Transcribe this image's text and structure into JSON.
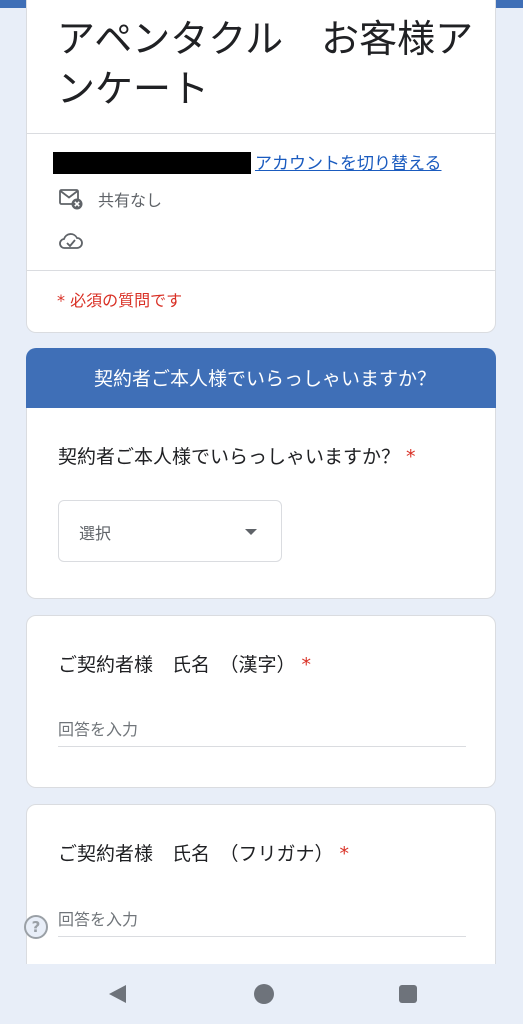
{
  "form": {
    "title": "アペンタクル　お客様アンケート",
    "switch_account_label": "アカウントを切り替える",
    "sharing_status": "共有なし",
    "required_note": "* 必須の質問です"
  },
  "section": {
    "title": "契約者ご本人様でいらっしゃいますか？"
  },
  "questions": [
    {
      "title": "契約者ご本人様でいらっしゃいますか？",
      "required_mark": "*",
      "type": "select",
      "selected": "選択"
    },
    {
      "title": "ご契約者様　氏名　（漢字）",
      "required_mark": "*",
      "type": "text",
      "placeholder": "回答を入力"
    },
    {
      "title": "ご契約者様　氏名　（フリガナ）",
      "required_mark": "*",
      "type": "text",
      "placeholder": "回答を入力"
    }
  ],
  "icons": {
    "sharing": "mail-blocked-icon",
    "cloud": "cloud-check-icon",
    "help": "help-icon",
    "nav_back": "back-icon",
    "nav_home": "home-icon",
    "nav_recent": "recent-apps-icon"
  },
  "help_glyph": "?",
  "colors": {
    "accent": "#3f6fb7",
    "link": "#1a5bbf",
    "required": "#d93025",
    "background": "#e8eef8"
  }
}
